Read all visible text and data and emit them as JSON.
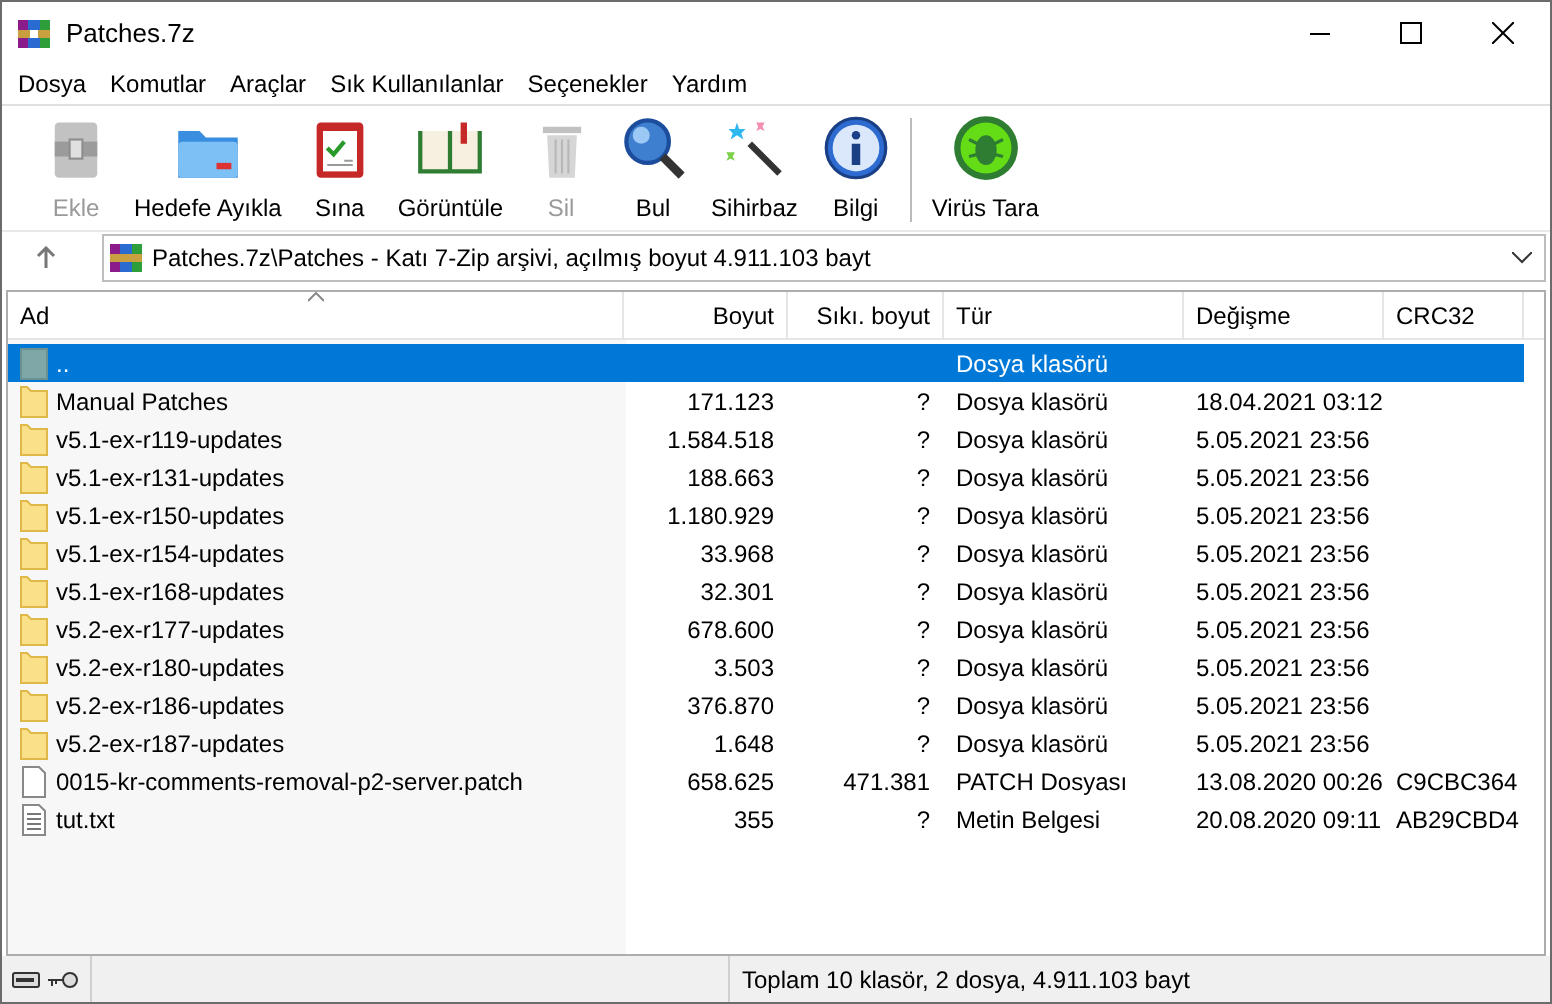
{
  "window": {
    "title": "Patches.7z"
  },
  "menu": [
    "Dosya",
    "Komutlar",
    "Araçlar",
    "Sık Kullanılanlar",
    "Seçenekler",
    "Yardım"
  ],
  "toolbar": [
    {
      "label": "Ekle",
      "kind": "add",
      "disabled": true
    },
    {
      "label": "Hedefe Ayıkla",
      "kind": "extract",
      "disabled": false
    },
    {
      "label": "Sına",
      "kind": "test",
      "disabled": false
    },
    {
      "label": "Görüntüle",
      "kind": "view",
      "disabled": false
    },
    {
      "label": "Sil",
      "kind": "delete",
      "disabled": true
    },
    {
      "label": "Bul",
      "kind": "find",
      "disabled": false
    },
    {
      "label": "Sihirbaz",
      "kind": "wizard",
      "disabled": false
    },
    {
      "label": "Bilgi",
      "kind": "info",
      "disabled": false
    },
    {
      "label": "Virüs Tara",
      "kind": "virus",
      "disabled": false
    }
  ],
  "address": "Patches.7z\\Patches - Katı 7-Zip arşivi, açılmış boyut 4.911.103 bayt",
  "table": {
    "columns": [
      "Ad",
      "Boyut",
      "Sıkı. boyut",
      "Tür",
      "Değişme",
      "CRC32"
    ],
    "rows": [
      {
        "kind": "parent",
        "selected": true,
        "cells": [
          "..",
          "",
          "",
          "Dosya klasörü",
          "",
          ""
        ]
      },
      {
        "kind": "folder",
        "selected": false,
        "cells": [
          "Manual Patches",
          "171.123",
          "?",
          "Dosya klasörü",
          "18.04.2021 03:12",
          ""
        ]
      },
      {
        "kind": "folder",
        "selected": false,
        "cells": [
          "v5.1-ex-r119-updates",
          "1.584.518",
          "?",
          "Dosya klasörü",
          "5.05.2021 23:56",
          ""
        ]
      },
      {
        "kind": "folder",
        "selected": false,
        "cells": [
          "v5.1-ex-r131-updates",
          "188.663",
          "?",
          "Dosya klasörü",
          "5.05.2021 23:56",
          ""
        ]
      },
      {
        "kind": "folder",
        "selected": false,
        "cells": [
          "v5.1-ex-r150-updates",
          "1.180.929",
          "?",
          "Dosya klasörü",
          "5.05.2021 23:56",
          ""
        ]
      },
      {
        "kind": "folder",
        "selected": false,
        "cells": [
          "v5.1-ex-r154-updates",
          "33.968",
          "?",
          "Dosya klasörü",
          "5.05.2021 23:56",
          ""
        ]
      },
      {
        "kind": "folder",
        "selected": false,
        "cells": [
          "v5.1-ex-r168-updates",
          "32.301",
          "?",
          "Dosya klasörü",
          "5.05.2021 23:56",
          ""
        ]
      },
      {
        "kind": "folder",
        "selected": false,
        "cells": [
          "v5.2-ex-r177-updates",
          "678.600",
          "?",
          "Dosya klasörü",
          "5.05.2021 23:56",
          ""
        ]
      },
      {
        "kind": "folder",
        "selected": false,
        "cells": [
          "v5.2-ex-r180-updates",
          "3.503",
          "?",
          "Dosya klasörü",
          "5.05.2021 23:56",
          ""
        ]
      },
      {
        "kind": "folder",
        "selected": false,
        "cells": [
          "v5.2-ex-r186-updates",
          "376.870",
          "?",
          "Dosya klasörü",
          "5.05.2021 23:56",
          ""
        ]
      },
      {
        "kind": "folder",
        "selected": false,
        "cells": [
          "v5.2-ex-r187-updates",
          "1.648",
          "?",
          "Dosya klasörü",
          "5.05.2021 23:56",
          ""
        ]
      },
      {
        "kind": "file",
        "selected": false,
        "cells": [
          "0015-kr-comments-removal-p2-server.patch",
          "658.625",
          "471.381",
          "PATCH Dosyası",
          "13.08.2020 00:26",
          "C9CBC364"
        ]
      },
      {
        "kind": "text",
        "selected": false,
        "cells": [
          "tut.txt",
          "355",
          "?",
          "Metin Belgesi",
          "20.08.2020 09:11",
          "AB29CBD4"
        ]
      }
    ]
  },
  "status_bar": "Toplam 10 klasör, 2 dosya, 4.911.103 bayt"
}
